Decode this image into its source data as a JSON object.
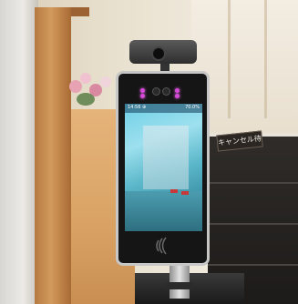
{
  "photo": {
    "device_status_left": "14:56 ⊕",
    "device_status_right": "70.0%",
    "counter_sign": "キャンセル待"
  }
}
